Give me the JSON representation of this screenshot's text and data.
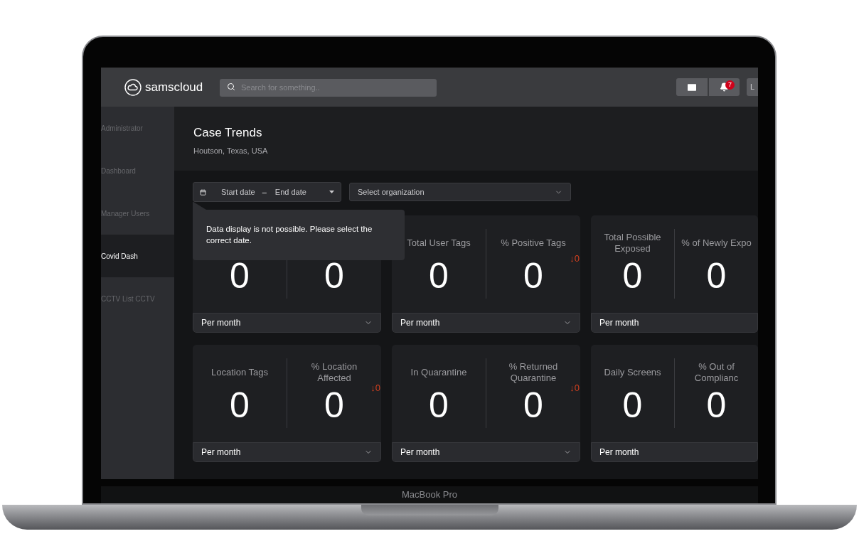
{
  "brand": {
    "name": "samscloud"
  },
  "search": {
    "placeholder": "Search for something.."
  },
  "notifications": {
    "count": "7"
  },
  "user": {
    "initial": "L"
  },
  "sidebar": {
    "items": [
      {
        "label": "Administrator",
        "selected": false
      },
      {
        "label": "Dashboard",
        "selected": false
      },
      {
        "label": "Manager Users",
        "selected": false
      },
      {
        "label": "Covid Dash",
        "selected": true
      },
      {
        "label": "CCTV List CCTV",
        "selected": false
      }
    ]
  },
  "page": {
    "title": "Case Trends",
    "subtitle": "Houtson, Texas, USA"
  },
  "date_range": {
    "start": {
      "placeholder": "Start date"
    },
    "separator": "–",
    "end": {
      "placeholder": "End date"
    }
  },
  "organization_select": {
    "placeholder": "Select organization"
  },
  "tooltip": {
    "text": "Data display is not possible. Please select the correct date."
  },
  "cards": [
    {
      "metrics": [
        {
          "value": "0"
        },
        {
          "value": "0"
        }
      ],
      "period": "Per month"
    },
    {
      "metrics": [
        {
          "label": "Total User Tags",
          "value": "0"
        },
        {
          "label": "% Positive Tags",
          "value": "0"
        }
      ],
      "change": "↓0",
      "period": "Per month"
    },
    {
      "metrics": [
        {
          "label": "Total Possible Exposed",
          "value": "0"
        },
        {
          "label": "% of Newly Expo",
          "value": "0"
        }
      ],
      "period": "Per month"
    },
    {
      "metrics": [
        {
          "label": "Location Tags",
          "value": "0"
        },
        {
          "label": "% Location Affected",
          "value": "0"
        }
      ],
      "change": "↓0",
      "period": "Per month"
    },
    {
      "metrics": [
        {
          "label": "In Quarantine",
          "value": "0"
        },
        {
          "label": "% Returned Quarantine",
          "value": "0"
        }
      ],
      "change": "↓0",
      "period": "Per month"
    },
    {
      "metrics": [
        {
          "label": "Daily Screens",
          "value": "0"
        },
        {
          "label": "% Out of Complianc",
          "value": "0"
        }
      ],
      "period": "Per month"
    }
  ],
  "device": {
    "label": "MacBook Pro"
  }
}
